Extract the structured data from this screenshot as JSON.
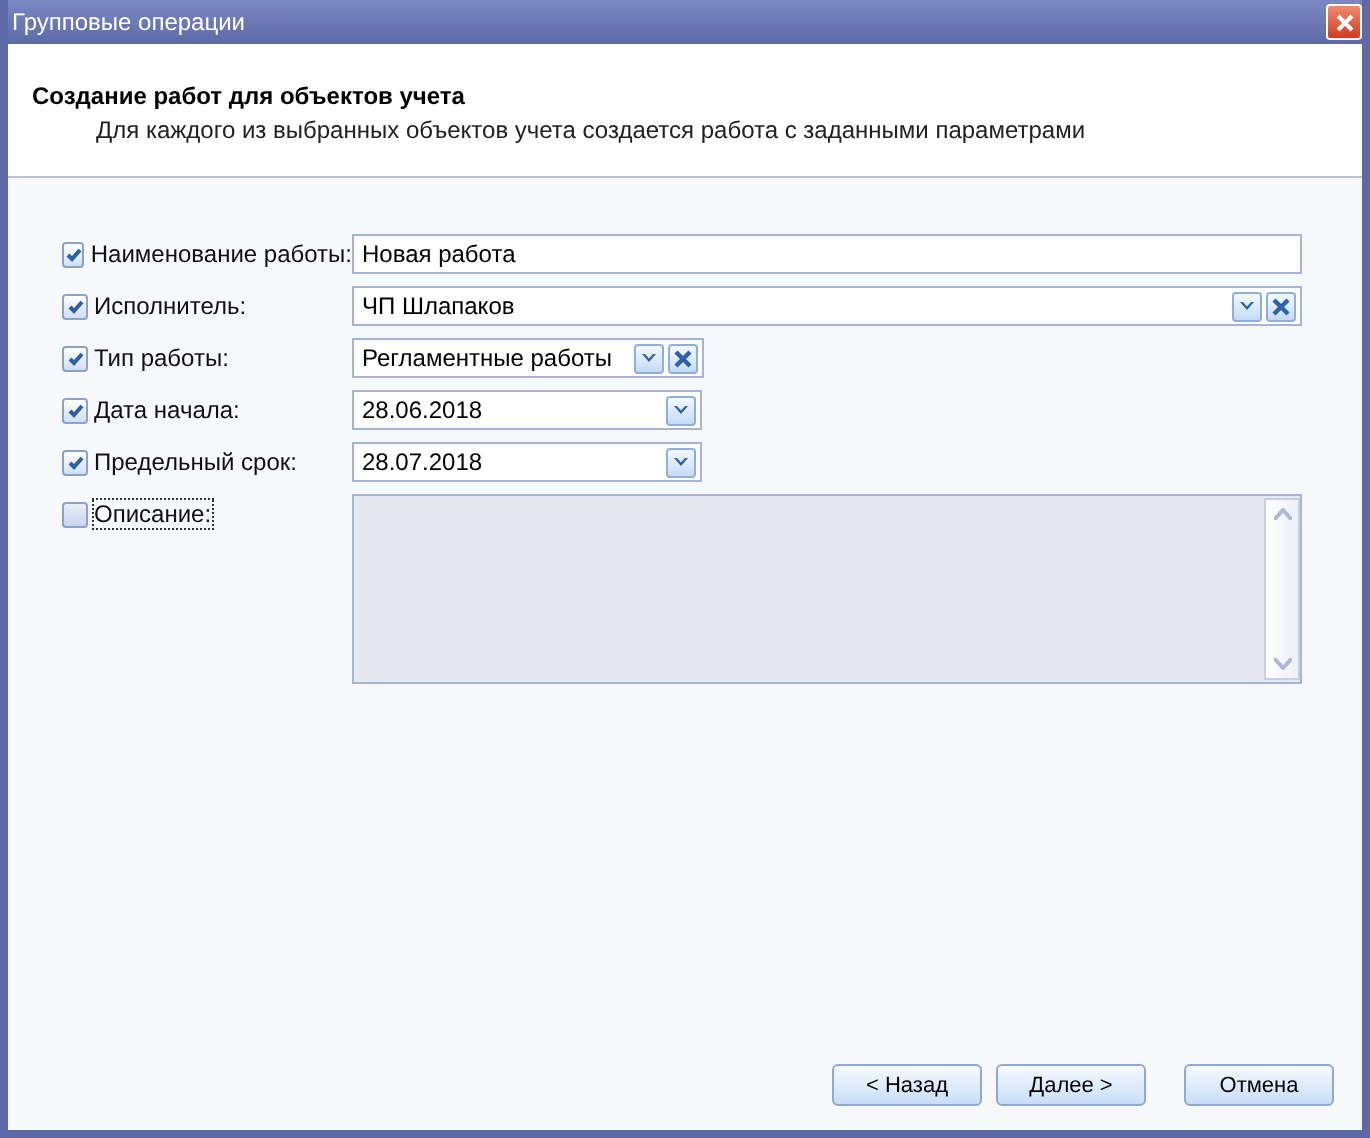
{
  "window": {
    "title": "Групповые операции"
  },
  "header": {
    "title": "Создание работ для объектов учета",
    "subtitle": "Для каждого из выбранных объектов учета создается работа с заданными параметрами"
  },
  "fields": [
    {
      "kind": "text",
      "label": "Наименование работы:",
      "checked": true,
      "focused": false,
      "value": "Новая работа"
    },
    {
      "kind": "combo",
      "label": "Исполнитель:",
      "checked": true,
      "focused": false,
      "value": "ЧП Шлапаков",
      "wide": true
    },
    {
      "kind": "combo",
      "label": "Тип работы:",
      "checked": true,
      "focused": false,
      "value": "Регламентные работы",
      "wide": false
    },
    {
      "kind": "date",
      "label": "Дата начала:",
      "checked": true,
      "focused": false,
      "value": "28.06.2018"
    },
    {
      "kind": "date",
      "label": "Предельный срок:",
      "checked": true,
      "focused": false,
      "value": "28.07.2018"
    },
    {
      "kind": "memo",
      "label": "Описание:",
      "checked": false,
      "focused": true
    }
  ],
  "buttons": [
    {
      "label": "< Назад"
    },
    {
      "label": "Далее >"
    },
    {
      "label": "Отмена"
    }
  ]
}
